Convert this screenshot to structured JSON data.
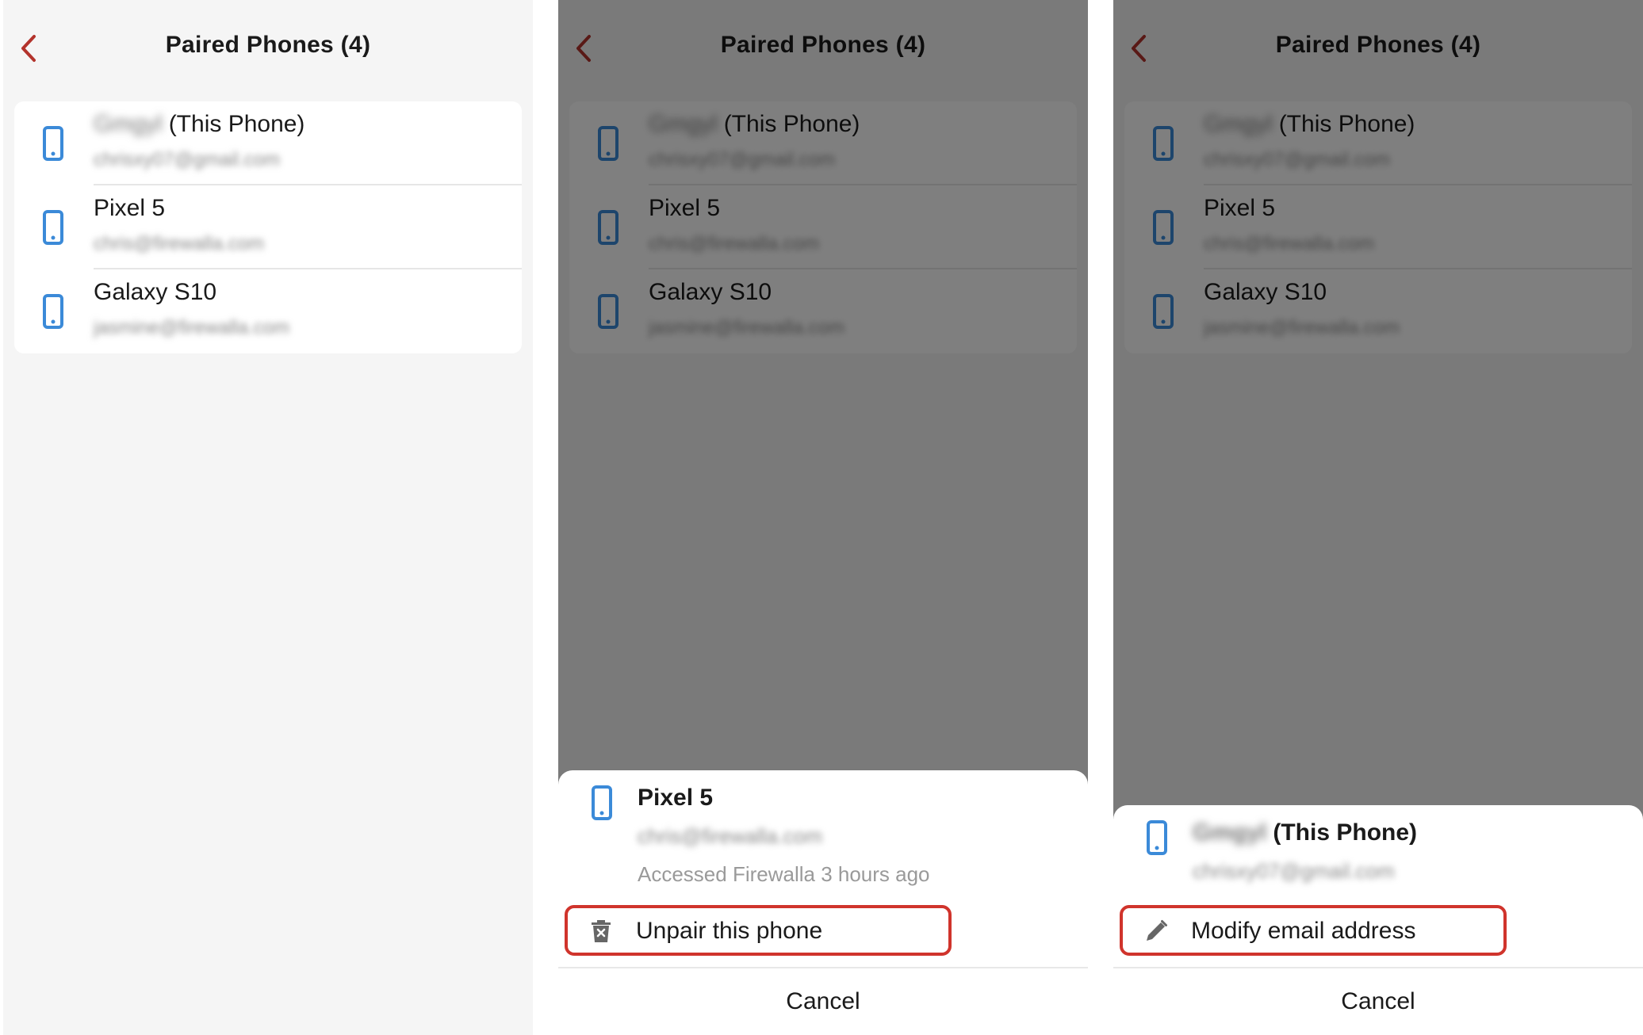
{
  "colors": {
    "accent": "#b3332c",
    "phone_icon": "#3b8ad8",
    "highlight_border": "#d0342c",
    "overlay": "rgba(0,0,0,0.5)"
  },
  "nav": {
    "title": "Paired Phones (4)",
    "back_icon": "chevron-left-icon"
  },
  "phones": [
    {
      "name_blur": "Gmgyl",
      "name": "(This Phone)",
      "email": "chrisxy07@gmail.com"
    },
    {
      "name_blur": "",
      "name": "Pixel 5",
      "email": "chris@firewalla.com"
    },
    {
      "name_blur": "",
      "name": "Galaxy S10",
      "email": "jasmine@firewalla.com"
    }
  ],
  "sheet_unpair": {
    "name": "Pixel 5",
    "email": "chris@firewalla.com",
    "meta": "Accessed Firewalla 3 hours ago",
    "action_icon": "trash-icon",
    "action_label": "Unpair this phone",
    "cancel_label": "Cancel"
  },
  "sheet_modify": {
    "name_blur": "Gmgyl",
    "name": "(This Phone)",
    "email": "chrisxy07@gmail.com",
    "action_icon": "pencil-icon",
    "action_label": "Modify email address",
    "cancel_label": "Cancel"
  }
}
